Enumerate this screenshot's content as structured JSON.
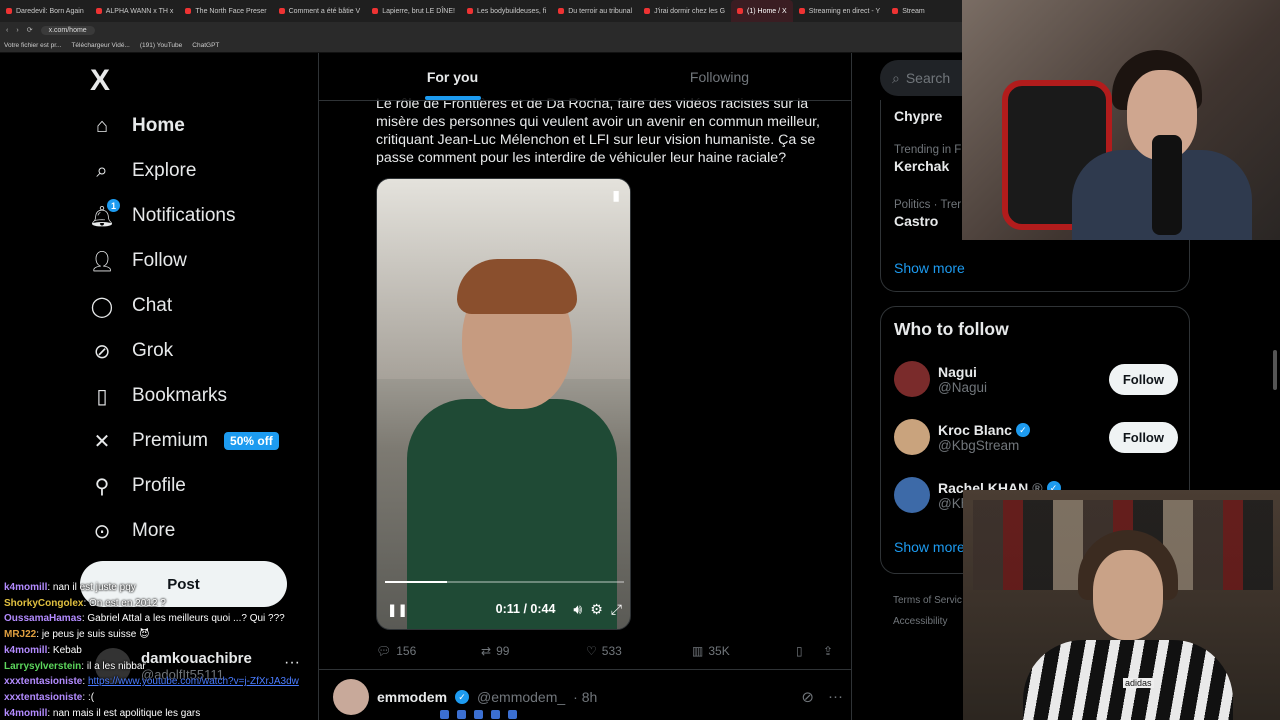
{
  "browser": {
    "tabs": [
      {
        "label": "Daredevil: Born Again"
      },
      {
        "label": "ALPHA WANN x TH x"
      },
      {
        "label": "The North Face Preser"
      },
      {
        "label": "Comment a été bâtie V"
      },
      {
        "label": "Lapierre, brut LE DÎNE!"
      },
      {
        "label": "Les bodybuildeuses, fi"
      },
      {
        "label": "Du terroir au tribunal"
      },
      {
        "label": "J'irai dormir chez les G"
      },
      {
        "label": "(1) Home / X"
      },
      {
        "label": "Streaming en direct - Y"
      },
      {
        "label": "Stream"
      }
    ],
    "active_tab_index": 8,
    "url": "x.com/home",
    "bookmarks": [
      "Votre fichier est pr...",
      "Téléchargeur Vidé...",
      "(191) YouTube",
      "ChatGPT"
    ]
  },
  "nav": {
    "logo": "X",
    "items": [
      {
        "label": "Home",
        "icon": "home-icon"
      },
      {
        "label": "Explore",
        "icon": "search-icon"
      },
      {
        "label": "Notifications",
        "icon": "bell-icon",
        "badge": "1"
      },
      {
        "label": "Follow",
        "icon": "add-user-icon"
      },
      {
        "label": "Chat",
        "icon": "chat-icon"
      },
      {
        "label": "Grok",
        "icon": "grok-icon"
      },
      {
        "label": "Bookmarks",
        "icon": "bookmark-icon"
      },
      {
        "label": "Premium",
        "icon": "x-icon",
        "promo": "50% off"
      },
      {
        "label": "Profile",
        "icon": "person-icon"
      },
      {
        "label": "More",
        "icon": "more-icon"
      }
    ],
    "post_label": "Post",
    "account": {
      "name": "damkouachibre",
      "handle": "@adolfIt55111"
    }
  },
  "feed": {
    "tabs": [
      {
        "label": "For you"
      },
      {
        "label": "Following"
      }
    ],
    "tweet": {
      "text": "Le rôle de Frontières et de Da Rocha, faire des vidéos racistes sur la misère des personnes qui veulent avoir un avenir en commun meilleur, critiquant Jean-Luc Mélenchon et LFI sur leur vision humaniste. Ça se passe comment pour les interdire de véhiculer leur haine raciale?",
      "video": {
        "time": "0:11 / 0:44",
        "progress": 0.26
      },
      "stats": {
        "replies": "156",
        "reposts": "99",
        "likes": "533",
        "views": "35K"
      }
    },
    "next_tweet": {
      "name": "emmodem",
      "handle": "@emmodem_",
      "time": "· 8h"
    }
  },
  "right": {
    "search_placeholder": "Search",
    "trends": [
      {
        "category": "",
        "name": "Chypre"
      },
      {
        "category": "Trending in F",
        "name": "Kerchak"
      },
      {
        "category": "Politics · Trer",
        "name": "Castro"
      }
    ],
    "show_more": "Show more",
    "who_to_follow": {
      "title": "Who to follow",
      "items": [
        {
          "name": "Nagui",
          "handle": "@Nagui",
          "button": "Follow",
          "verified": false,
          "avatar_color": "#7a2b2b"
        },
        {
          "name": "Kroc Blanc",
          "handle": "@KbgStream",
          "button": "Follow",
          "verified": true,
          "avatar_color": "#c9a37d"
        },
        {
          "name": "Rachel KHAN",
          "handle": "@Kh",
          "button": "",
          "verified": true,
          "avatar_color": "#3d6aa8"
        }
      ],
      "show_more": "Show more"
    },
    "footer": [
      "Terms of Servic",
      "Accessibility"
    ]
  },
  "chat": [
    {
      "user": "k4momill",
      "color": "#b38bff",
      "msg": "nan il est juste pqy"
    },
    {
      "user": "ShorkyCongolex",
      "color": "#e0c040",
      "msg": "On est en 2012 ?"
    },
    {
      "user": "OussamaHamas",
      "color": "#b38bff",
      "msg": "Gabriel Attal a les meilleurs quoi ...? Qui ???"
    },
    {
      "user": "MRJ22",
      "color": "#e0a040",
      "msg": "je peus je suis suisse 😈"
    },
    {
      "user": "k4momill",
      "color": "#b38bff",
      "msg": "Kebab"
    },
    {
      "user": "Larrysylverstein",
      "color": "#5cd65c",
      "msg": "il a les nibbar"
    },
    {
      "user": "xxxtentasioniste",
      "color": "#b38bff",
      "msg": "",
      "link": "https://www.youtube.com/watch?v=j-ZfXrJA3dw"
    },
    {
      "user": "xxxtentasioniste",
      "color": "#b38bff",
      "msg": ":("
    },
    {
      "user": "k4momill",
      "color": "#b38bff",
      "msg": "nan mais il est apolitique les gars"
    }
  ],
  "webcam_brand": "adidas",
  "colors": {
    "accent": "#1d9bf0",
    "background": "#000000",
    "border": "#2f3336"
  }
}
